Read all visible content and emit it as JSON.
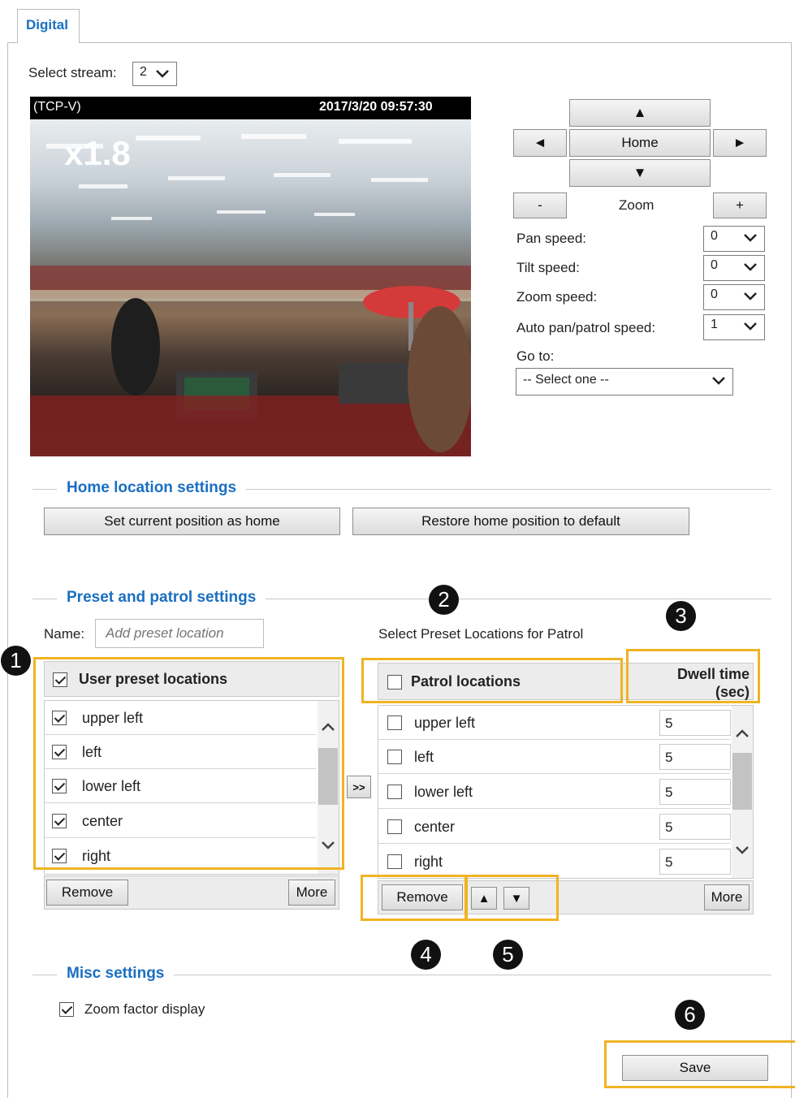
{
  "tab": {
    "label": "Digital"
  },
  "stream": {
    "label": "Select stream:",
    "value": "2"
  },
  "video": {
    "protocol": "(TCP-V)",
    "timestamp": "2017/3/20 09:57:30",
    "zoom_factor": "x1.8"
  },
  "ptz": {
    "up": "▲",
    "down": "▼",
    "left": "◄",
    "right": "►",
    "home": "Home",
    "zoom_out": "-",
    "zoom_label": "Zoom",
    "zoom_in": "+",
    "pan_speed_label": "Pan speed:",
    "pan_speed": "0",
    "tilt_speed_label": "Tilt speed:",
    "tilt_speed": "0",
    "zoom_speed_label": "Zoom speed:",
    "zoom_speed": "0",
    "auto_speed_label": "Auto pan/patrol speed:",
    "auto_speed": "1",
    "goto_label": "Go to:",
    "goto_value": "-- Select one --"
  },
  "home_section": {
    "title": "Home location settings",
    "set_home": "Set current position as home",
    "restore_home": "Restore home position to default"
  },
  "preset_section": {
    "title": "Preset and patrol settings",
    "name_label": "Name:",
    "name_placeholder": "Add preset location",
    "patrol_caption": "Select Preset Locations for Patrol",
    "user_header": "User preset locations",
    "user_items": [
      "upper left",
      "left",
      "lower left",
      "center",
      "right"
    ],
    "transfer": ">>",
    "remove": "Remove",
    "more": "More",
    "patrol_header": "Patrol locations",
    "dwell_header_1": "Dwell time",
    "dwell_header_2": "(sec)",
    "patrol_items": [
      "upper left",
      "left",
      "lower left",
      "center",
      "right"
    ],
    "dwell_values": [
      "5",
      "5",
      "5",
      "5",
      "5"
    ],
    "move_up": "▲",
    "move_down": "▼"
  },
  "misc_section": {
    "title": "Misc settings",
    "zoom_display": "Zoom factor display"
  },
  "save": "Save",
  "badges": [
    "1",
    "2",
    "3",
    "4",
    "5",
    "6"
  ],
  "colors": {
    "accent": "#1a6fc1",
    "highlight": "#f0b323"
  }
}
